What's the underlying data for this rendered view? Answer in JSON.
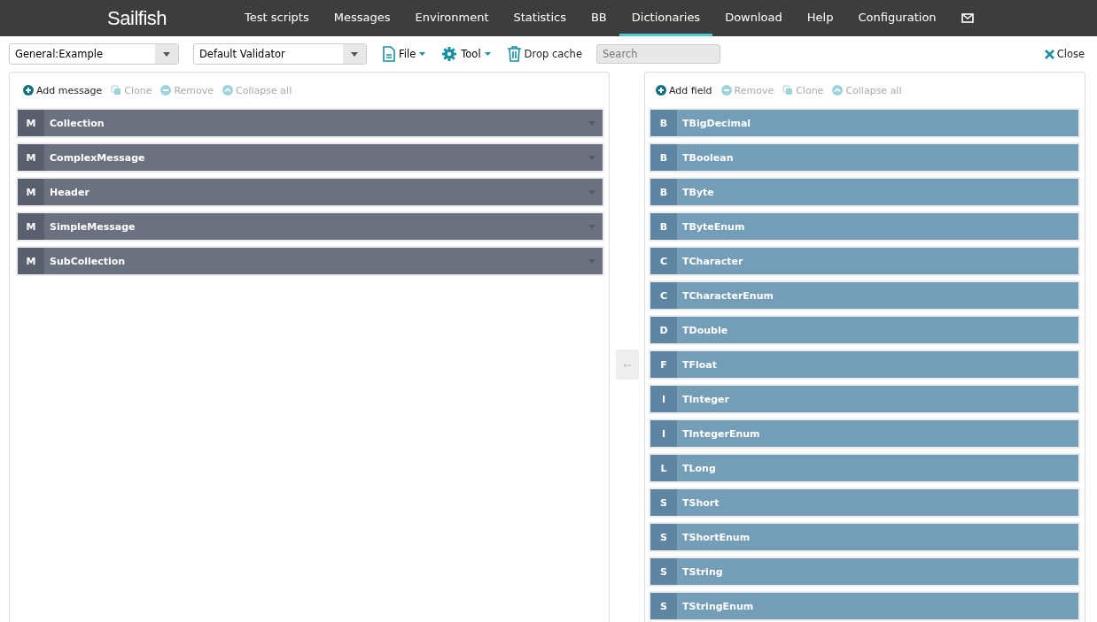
{
  "nav": {
    "logo": "Sailfish",
    "items": [
      {
        "label": "Test scripts",
        "selected": false
      },
      {
        "label": "Messages",
        "selected": false
      },
      {
        "label": "Environment",
        "selected": false
      },
      {
        "label": "Statistics",
        "selected": false
      },
      {
        "label": "BB",
        "selected": false
      },
      {
        "label": "Dictionaries",
        "selected": true
      },
      {
        "label": "Download",
        "selected": false
      },
      {
        "label": "Help",
        "selected": false
      },
      {
        "label": "Configuration",
        "selected": false
      }
    ]
  },
  "toolbar": {
    "dictionary": "General:Example",
    "validator": "Default Validator",
    "file": "File",
    "tool": "Tool",
    "drop_cache": "Drop cache",
    "search": {
      "placeholder": "Search"
    },
    "close": "Close"
  },
  "messages_panel": {
    "actions": [
      {
        "kind": "add",
        "label": "Add message",
        "disabled": false
      },
      {
        "kind": "clone",
        "label": "Clone",
        "disabled": true
      },
      {
        "kind": "remove",
        "label": "Remove",
        "disabled": true
      },
      {
        "kind": "collapse",
        "label": "Collapse all",
        "disabled": true
      }
    ],
    "items": [
      {
        "type": "M",
        "name": "Collection"
      },
      {
        "type": "M",
        "name": "ComplexMessage"
      },
      {
        "type": "M",
        "name": "Header"
      },
      {
        "type": "M",
        "name": "SimpleMessage"
      },
      {
        "type": "M",
        "name": "SubCollection"
      }
    ]
  },
  "fields_panel": {
    "actions": [
      {
        "kind": "add",
        "label": "Add field",
        "disabled": false
      },
      {
        "kind": "remove",
        "label": "Remove",
        "disabled": true
      },
      {
        "kind": "clone",
        "label": "Clone",
        "disabled": true
      },
      {
        "kind": "collapse",
        "label": "Collapse all",
        "disabled": true
      }
    ],
    "items": [
      {
        "type": "B",
        "name": "TBigDecimal"
      },
      {
        "type": "B",
        "name": "TBoolean"
      },
      {
        "type": "B",
        "name": "TByte"
      },
      {
        "type": "B",
        "name": "TByteEnum"
      },
      {
        "type": "C",
        "name": "TCharacter"
      },
      {
        "type": "C",
        "name": "TCharacterEnum"
      },
      {
        "type": "D",
        "name": "TDouble"
      },
      {
        "type": "F",
        "name": "TFloat"
      },
      {
        "type": "I",
        "name": "TInteger"
      },
      {
        "type": "I",
        "name": "TIntegerEnum"
      },
      {
        "type": "L",
        "name": "TLong"
      },
      {
        "type": "S",
        "name": "TShort"
      },
      {
        "type": "S",
        "name": "TShortEnum"
      },
      {
        "type": "S",
        "name": "TString"
      },
      {
        "type": "S",
        "name": "TStringEnum"
      }
    ]
  }
}
